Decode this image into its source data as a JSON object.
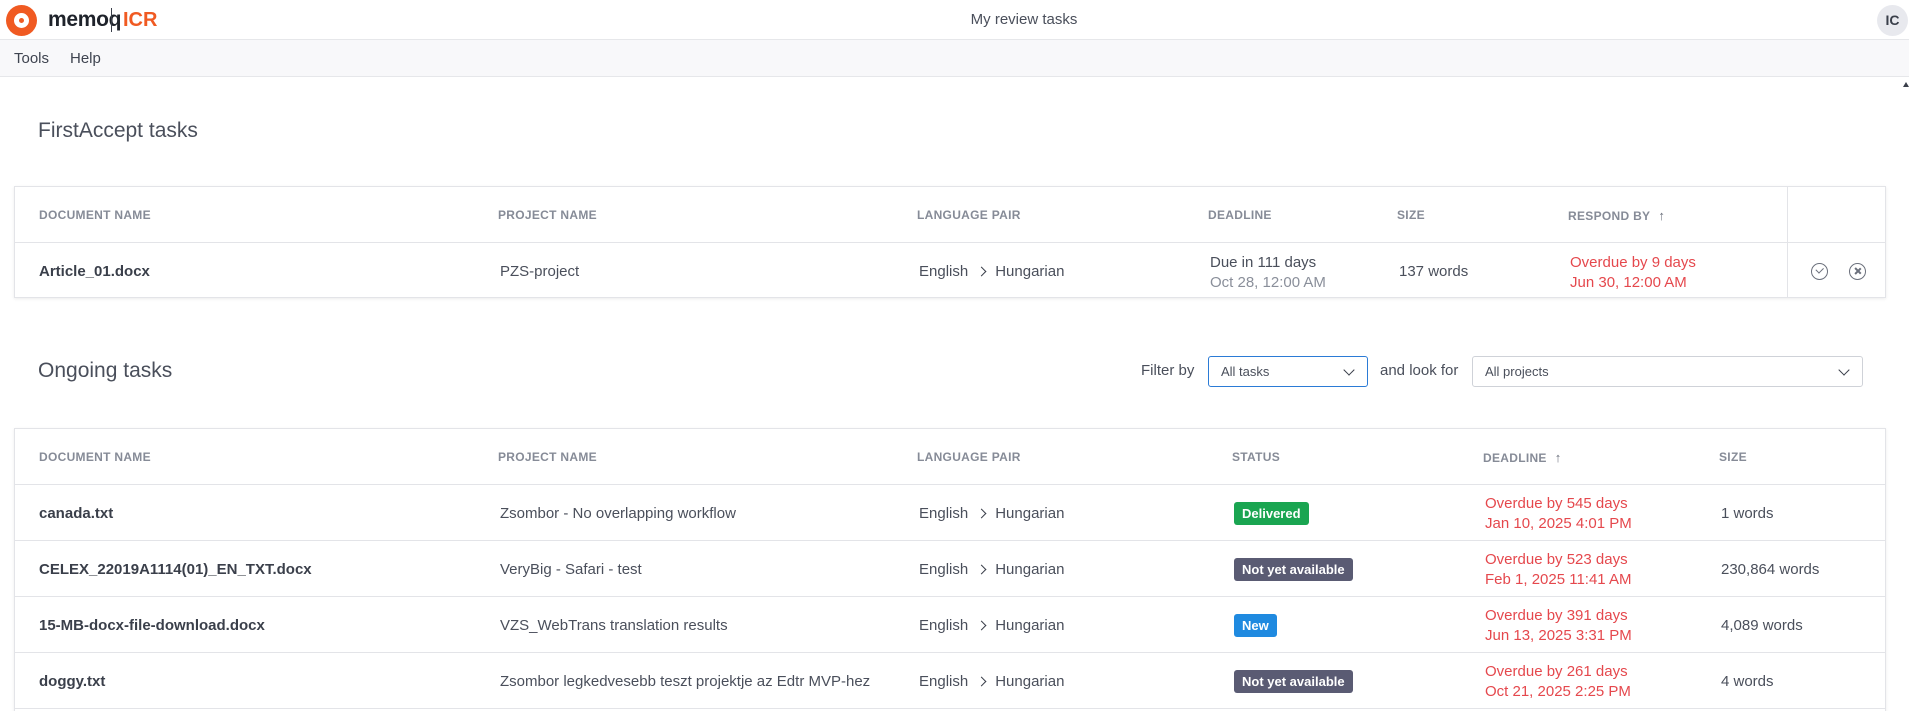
{
  "app": {
    "brand": "memoq",
    "product": "ICR",
    "page_heading": "My review tasks",
    "user_initials": "IC"
  },
  "menu": [
    "Tools",
    "Help"
  ],
  "first_accept": {
    "title": "FirstAccept tasks",
    "columns": [
      "DOCUMENT NAME",
      "PROJECT NAME",
      "LANGUAGE PAIR",
      "DEADLINE",
      "SIZE",
      "RESPOND BY"
    ],
    "rows": [
      {
        "document": "Article_01.docx",
        "project": "PZS-project",
        "source_lang": "English",
        "target_lang": "Hungarian",
        "deadline_rel": "Due in 111 days",
        "deadline_abs": "Oct 28, 12:00 AM",
        "size": "137 words",
        "respond_rel": "Overdue by 9 days",
        "respond_abs": "Jun 30, 12:00 AM"
      }
    ]
  },
  "ongoing": {
    "title": "Ongoing tasks",
    "filter_label": "Filter by",
    "filter_value": "All tasks",
    "look_label": "and look for",
    "look_value": "All projects",
    "columns": [
      "DOCUMENT NAME",
      "PROJECT NAME",
      "LANGUAGE PAIR",
      "STATUS",
      "DEADLINE",
      "SIZE"
    ],
    "rows": [
      {
        "document": "canada.txt",
        "project": "Zsombor - No overlapping workflow",
        "source_lang": "English",
        "target_lang": "Hungarian",
        "status": "Delivered",
        "deadline_rel": "Overdue by 545 days",
        "deadline_abs": "Jan 10, 2025 4:01 PM",
        "size": "1 words"
      },
      {
        "document": "CELEX_22019A1114(01)_EN_TXT.docx",
        "project": "VeryBig - Safari - test",
        "source_lang": "English",
        "target_lang": "Hungarian",
        "status": "Not yet available",
        "deadline_rel": "Overdue by 523 days",
        "deadline_abs": "Feb 1, 2025 11:41 AM",
        "size": "230,864 words"
      },
      {
        "document": "15-MB-docx-file-download.docx",
        "project": "VZS_WebTrans translation results",
        "source_lang": "English",
        "target_lang": "Hungarian",
        "status": "New",
        "deadline_rel": "Overdue by 391 days",
        "deadline_abs": "Jun 13, 2025 3:31 PM",
        "size": "4,089 words"
      },
      {
        "document": "doggy.txt",
        "project": "Zsombor legkedvesebb teszt projektje az Edtr MVP-hez",
        "source_lang": "English",
        "target_lang": "Hungarian",
        "status": "Not yet available",
        "deadline_rel": "Overdue by 261 days",
        "deadline_abs": "Oct 21, 2025 2:25 PM",
        "size": "4 words"
      }
    ]
  }
}
